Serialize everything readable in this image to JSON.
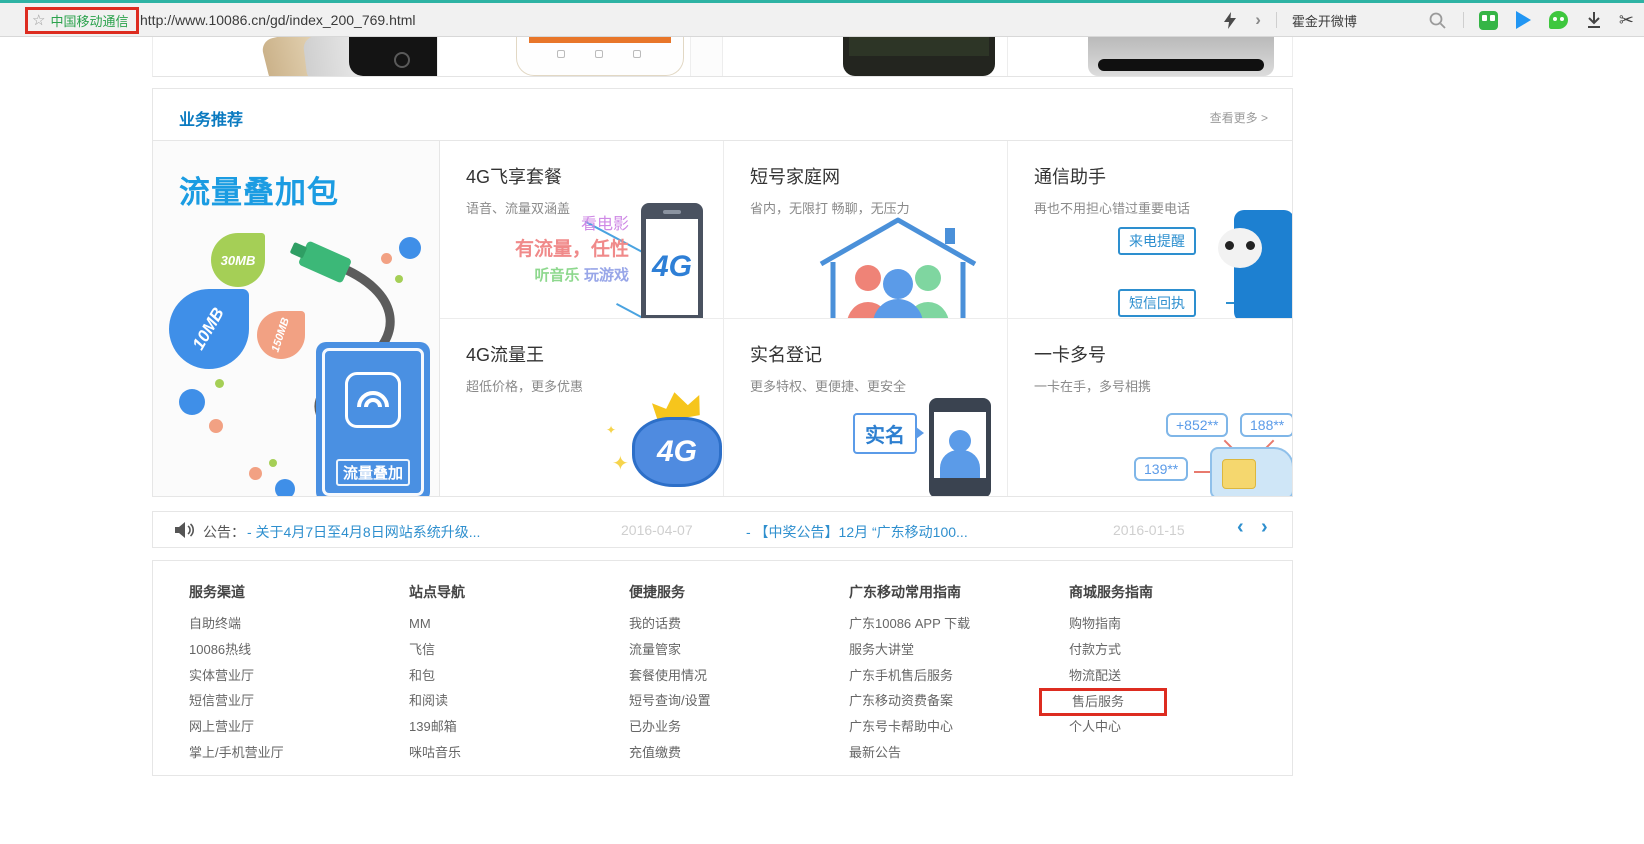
{
  "browser": {
    "bookmark": "中国移动通信",
    "url": "http://www.10086.cn/gd/index_200_769.html",
    "hotword": "霍金开微博",
    "star_icon": "☆",
    "chevron": "›",
    "scissors_icon": "✂"
  },
  "recommend": {
    "title": "业务推荐",
    "more": "查看更多 >",
    "promo": {
      "title": "流量叠加包",
      "drops": [
        "30MB",
        "10MB",
        "150MB"
      ],
      "card_label": "流量叠加"
    },
    "services": [
      {
        "title": "4G飞享套餐",
        "subtitle": "语音、流量双涵盖",
        "art": {
          "movie": "看电影",
          "flow": "有流量，任性",
          "music": "听音乐",
          "game": "玩游戏",
          "badge": "4G"
        }
      },
      {
        "title": "短号家庭网",
        "subtitle": "省内，无限打 畅聊，无压力"
      },
      {
        "title": "通信助手",
        "subtitle": "再也不用担心错过重要电话",
        "art": {
          "tag1": "来电提醒",
          "tag2": "短信回执"
        }
      },
      {
        "title": "4G流量王",
        "subtitle": "超低价格，更多优惠",
        "art": {
          "badge": "4G",
          "sparkle": "✦"
        }
      },
      {
        "title": "实名登记",
        "subtitle": "更多特权、更便捷、更安全",
        "art": {
          "bubble": "实名"
        }
      },
      {
        "title": "一卡多号",
        "subtitle": "一卡在手，多号相携",
        "art": {
          "tag1": "+852**",
          "tag2": "188**",
          "tag3": "139**"
        }
      }
    ]
  },
  "notice": {
    "label": "公告：",
    "items": [
      {
        "text": "- 关于4月7日至4月8日网站系统升级...",
        "date": "2016-04-07"
      },
      {
        "text": "- 【中奖公告】12月 “广东移动100...",
        "date": "2016-01-15"
      }
    ],
    "prev": "‹",
    "next": "›"
  },
  "footer": {
    "columns": [
      {
        "heading": "服务渠道",
        "links": [
          "自助终端",
          "10086热线",
          "实体营业厅",
          "短信营业厅",
          "网上营业厅",
          "掌上/手机营业厅"
        ]
      },
      {
        "heading": "站点导航",
        "links": [
          "MM",
          "飞信",
          "和包",
          "和阅读",
          "139邮箱",
          "咪咕音乐"
        ]
      },
      {
        "heading": "便捷服务",
        "links": [
          "我的话费",
          "流量管家",
          "套餐使用情况",
          "短号查询/设置",
          "已办业务",
          "充值缴费"
        ]
      },
      {
        "heading": "广东移动常用指南",
        "links": [
          "广东10086 APP 下载",
          "服务大讲堂",
          "广东手机售后服务",
          "广东移动资费备案",
          "广东号卡帮助中心",
          "最新公告"
        ]
      },
      {
        "heading": "商城服务指南",
        "links": [
          "购物指南",
          "付款方式",
          "物流配送",
          "售后服务",
          "个人中心"
        ]
      }
    ]
  },
  "colors": {
    "accent_blue": "#0a7ac0",
    "promo_blue": "#1b9ce2",
    "link_blue": "#2e8fce",
    "brand_green": "#2ba24c",
    "highlight_red": "#dd2c20",
    "toolbar_teal": "#2eb3a4"
  }
}
